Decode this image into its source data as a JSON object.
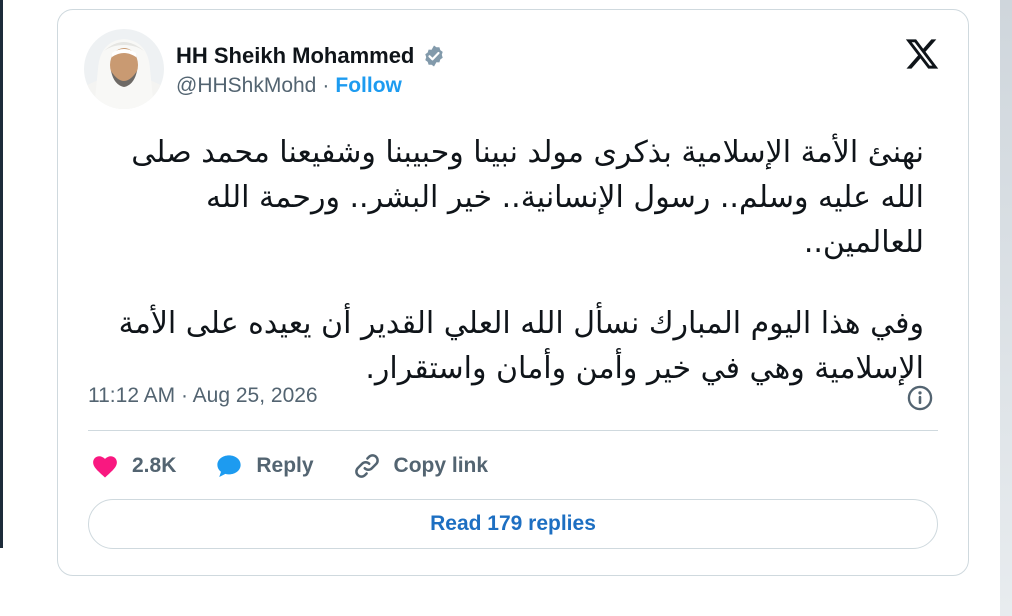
{
  "author": {
    "name": "HH Sheikh Mohammed",
    "handle": "@HHShkMohd",
    "separator": "·",
    "follow_label": "Follow"
  },
  "tweet": {
    "paragraphs": [
      "نهنئ الأمة الإسلامية بذكرى مولد نبينا وحبيبنا وشفيعنا محمد صلى الله عليه وسلم.. رسول الإنسانية.. خير البشر.. ورحمة الله للعالمين..",
      "وفي هذا اليوم المبارك نسأل الله العلي القدير أن يعيده على الأمة الإسلامية وهي في خير وأمن وأمان واستقرار."
    ],
    "timestamp": "11:12 AM · Aug 25, 2026"
  },
  "actions": {
    "like_count": "2.8K",
    "reply_label": "Reply",
    "copy_link_label": "Copy link"
  },
  "read_replies_label": "Read 179 replies",
  "colors": {
    "accent": "#1d9bf0",
    "like": "#f91880",
    "verified": "#829aab",
    "muted": "#536471"
  },
  "icons": [
    "verified-badge-icon",
    "x-logo-icon",
    "info-icon",
    "heart-icon",
    "reply-bubble-icon",
    "link-icon"
  ]
}
